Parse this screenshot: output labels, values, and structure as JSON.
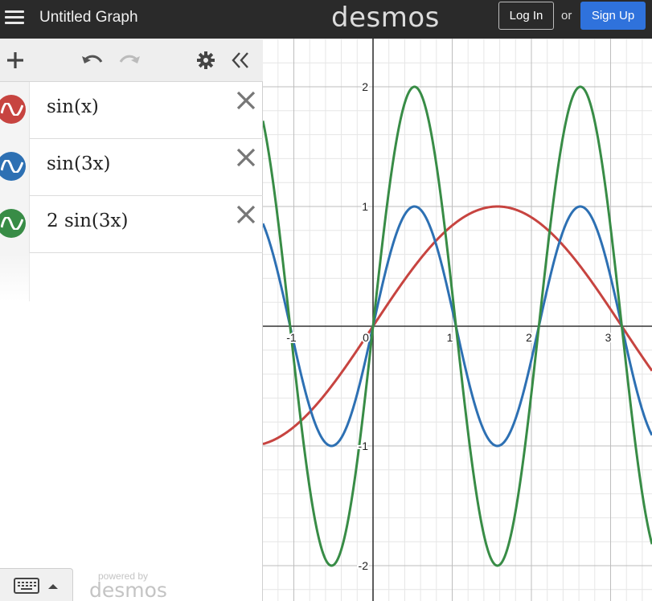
{
  "header": {
    "title": "Untitled Graph",
    "brand": "desmos",
    "login_label": "Log In",
    "or_text": "or",
    "signup_label": "Sign Up"
  },
  "toolbar": {
    "add_icon": "plus-icon",
    "undo_icon": "undo-icon",
    "redo_icon": "redo-icon",
    "settings_icon": "gear-icon",
    "collapse_icon": "double-chevron-left-icon"
  },
  "expressions": [
    {
      "text": "sin(x)",
      "color": "#c74440"
    },
    {
      "text": "sin(3x)",
      "color": "#2d70b3"
    },
    {
      "text": "2 sin(3x)",
      "color": "#388c46"
    }
  ],
  "footer": {
    "powered_by": "powered by",
    "brand": "desmos"
  },
  "graph": {
    "x_ticks": [
      "-1",
      "0",
      "1",
      "2",
      "3"
    ],
    "y_ticks": [
      "2",
      "1",
      "-1",
      "-2"
    ]
  }
}
